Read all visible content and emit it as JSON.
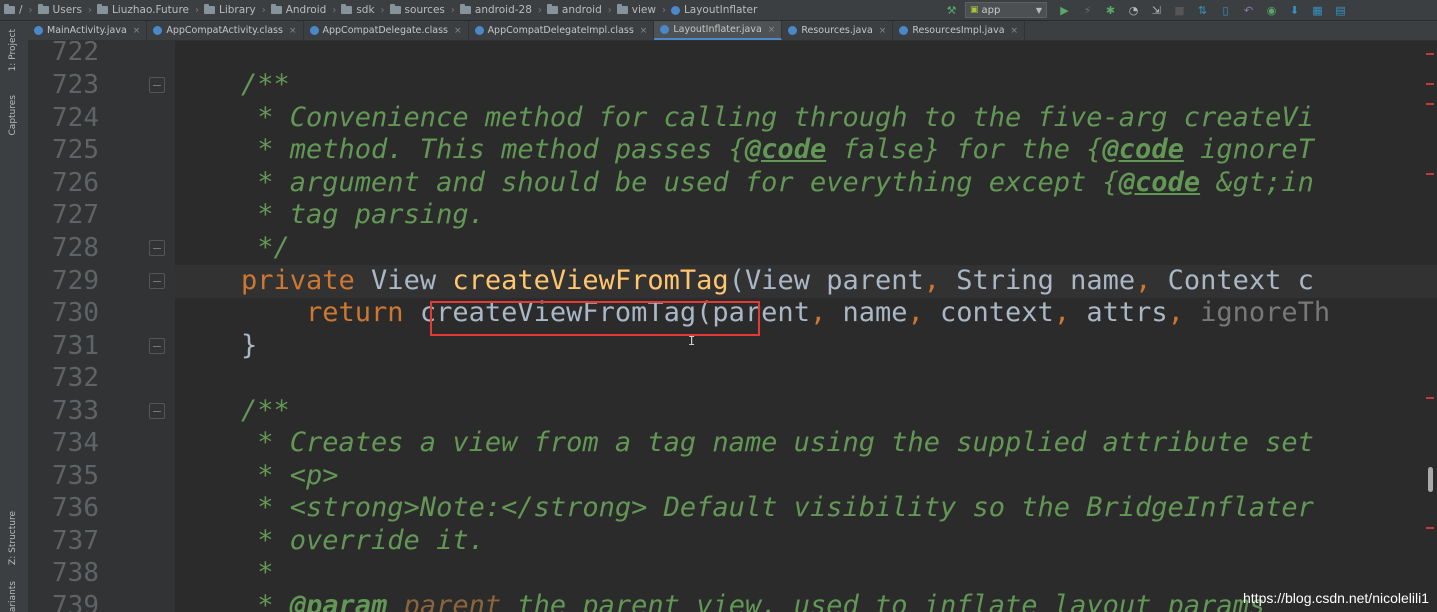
{
  "breadcrumbs": [
    "/",
    "Users",
    "Liuzhao.Future",
    "Library",
    "Android",
    "sdk",
    "sources",
    "android-28",
    "android",
    "view",
    "LayoutInflater"
  ],
  "run_config": "app",
  "tabs": [
    {
      "label": "MainActivity.java",
      "icon_color": "#4a88c7",
      "active": false
    },
    {
      "label": "AppCompatActivity.class",
      "icon_color": "#4a88c7",
      "active": false
    },
    {
      "label": "AppCompatDelegate.class",
      "icon_color": "#4a88c7",
      "active": false
    },
    {
      "label": "AppCompatDelegateImpl.class",
      "icon_color": "#4a88c7",
      "active": false
    },
    {
      "label": "LayoutInflater.java",
      "icon_color": "#4a88c7",
      "active": true
    },
    {
      "label": "Resources.java",
      "icon_color": "#4a88c7",
      "active": false
    },
    {
      "label": "ResourcesImpl.java",
      "icon_color": "#4a88c7",
      "active": false
    }
  ],
  "side_panels": {
    "project": "1: Project",
    "captures": "Captures",
    "structure": "Z: Structure",
    "variants": "ariants"
  },
  "code": {
    "ln722": "722",
    "ln723": "723",
    "l723": "/**",
    "ln724": "724",
    "l724": " * Convenience method for calling through to the five-arg createVi",
    "ln725": "725",
    "l725a": " * method. This method passes {",
    "l725b": "@code",
    "l725c": " false} for the {",
    "l725d": "@code",
    "l725e": " ignoreT",
    "ln726": "726",
    "l726a": " * argument and should be used for everything except {",
    "l726b": "@code",
    "l726c": " &gt;in",
    "ln727": "727",
    "l727": " * tag parsing.",
    "ln728": "728",
    "l728": " */",
    "ln729": "729",
    "l729a": "private",
    "l729b": " View ",
    "l729c": "createViewFromTag",
    "l729d": "(View parent",
    "l729e": ",",
    "l729f": " String name",
    "l729g": ",",
    "l729h": " Context c",
    "ln730": "730",
    "l730a": "    return",
    "l730b": " createViewFromTag(parent",
    "l730c": ",",
    "l730d": " name",
    "l730e": ",",
    "l730f": " context",
    "l730g": ",",
    "l730h": " attrs",
    "l730i": ",",
    "l730j": " ignoreTh",
    "ln731": "731",
    "l731": "}",
    "ln732": "732",
    "ln733": "733",
    "l733": "/**",
    "ln734": "734",
    "l734": " * Creates a view from a tag name using the supplied attribute set",
    "ln735": "735",
    "l735": " * <p>",
    "ln736": "736",
    "l736": " * <strong>Note:</strong> Default visibility so the BridgeInflater",
    "ln737": "737",
    "l737": " * override it.",
    "ln738": "738",
    "l738": " *",
    "ln739": "739",
    "l739a": " * ",
    "l739b": "@param",
    "l739c": " parent",
    "l739d": " the parent view, used to inflate layout params"
  },
  "cursor_glyph": "I",
  "watermark": "https://blog.csdn.net/nicolelili1",
  "colors": {
    "keyword": "#cc7832",
    "comment": "#629755",
    "method": "#ffc66d",
    "text": "#a9b7c6",
    "highlight_box": "#e53935"
  }
}
